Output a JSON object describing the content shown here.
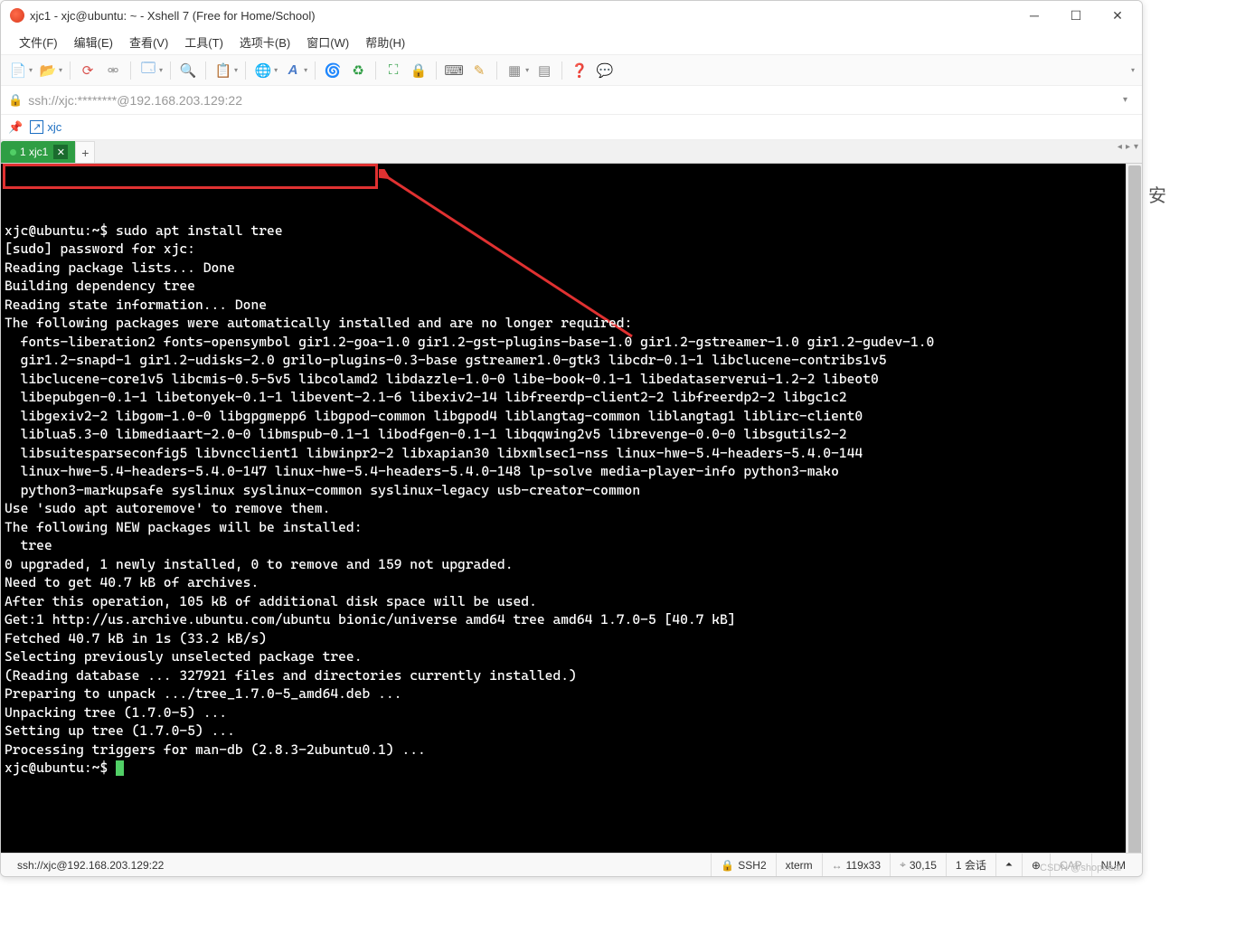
{
  "window": {
    "title": "xjc1 - xjc@ubuntu: ~ - Xshell 7 (Free for Home/School)"
  },
  "menu": {
    "file": "文件(F)",
    "edit": "编辑(E)",
    "view": "查看(V)",
    "tools": "工具(T)",
    "tabs": "选项卡(B)",
    "window": "窗口(W)",
    "help": "帮助(H)"
  },
  "address": {
    "text": "ssh://xjc:********@192.168.203.129:22"
  },
  "session_link": "xjc",
  "tab": {
    "label": "1 xjc1"
  },
  "terminal": {
    "prompt1": "xjc@ubuntu:~$",
    "command": " sudo apt install tree",
    "body": "[sudo] password for xjc:\nReading package lists... Done\nBuilding dependency tree\nReading state information... Done\nThe following packages were automatically installed and are no longer required:\n  fonts-liberation2 fonts-opensymbol gir1.2-goa-1.0 gir1.2-gst-plugins-base-1.0 gir1.2-gstreamer-1.0 gir1.2-gudev-1.0\n  gir1.2-snapd-1 gir1.2-udisks-2.0 grilo-plugins-0.3-base gstreamer1.0-gtk3 libcdr-0.1-1 libclucene-contribs1v5\n  libclucene-core1v5 libcmis-0.5-5v5 libcolamd2 libdazzle-1.0-0 libe-book-0.1-1 libedataserverui-1.2-2 libeot0\n  libepubgen-0.1-1 libetonyek-0.1-1 libevent-2.1-6 libexiv2-14 libfreerdp-client2-2 libfreerdp2-2 libgc1c2\n  libgexiv2-2 libgom-1.0-0 libgpgmepp6 libgpod-common libgpod4 liblangtag-common liblangtag1 liblirc-client0\n  liblua5.3-0 libmediaart-2.0-0 libmspub-0.1-1 libodfgen-0.1-1 libqqwing2v5 librevenge-0.0-0 libsgutils2-2\n  libsuitesparseconfig5 libvncclient1 libwinpr2-2 libxapian30 libxmlsec1-nss linux-hwe-5.4-headers-5.4.0-144\n  linux-hwe-5.4-headers-5.4.0-147 linux-hwe-5.4-headers-5.4.0-148 lp-solve media-player-info python3-mako\n  python3-markupsafe syslinux syslinux-common syslinux-legacy usb-creator-common\nUse 'sudo apt autoremove' to remove them.\nThe following NEW packages will be installed:\n  tree\n0 upgraded, 1 newly installed, 0 to remove and 159 not upgraded.\nNeed to get 40.7 kB of archives.\nAfter this operation, 105 kB of additional disk space will be used.\nGet:1 http://us.archive.ubuntu.com/ubuntu bionic/universe amd64 tree amd64 1.7.0-5 [40.7 kB]\nFetched 40.7 kB in 1s (33.2 kB/s)\nSelecting previously unselected package tree.\n(Reading database ... 327921 files and directories currently installed.)\nPreparing to unpack .../tree_1.7.0-5_amd64.deb ...\nUnpacking tree (1.7.0-5) ...\nSetting up tree (1.7.0-5) ...\nProcessing triggers for man-db (2.8.3-2ubuntu0.1) ...",
    "prompt2": "xjc@ubuntu:~$ "
  },
  "statusbar": {
    "conn": "ssh://xjc@192.168.203.129:22",
    "proto": "SSH2",
    "termtype": "xterm",
    "size": "119x33",
    "cursor": "30,15",
    "sessions": "1 会话",
    "caret_up": "⏶",
    "add": "⊕",
    "cap": "CAP",
    "num": "NUM"
  },
  "watermark": "CSDN @shopeeai",
  "cut_mark": "安"
}
